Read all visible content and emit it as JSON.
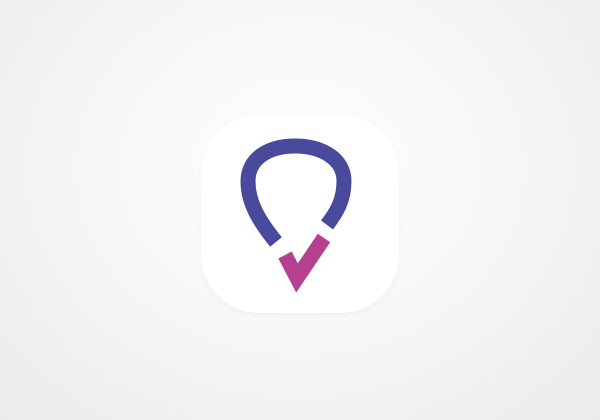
{
  "app_icon": {
    "name": "location-check-app-icon",
    "background": "#ffffff",
    "logo": {
      "pin_color": "#4a4a9c",
      "check_color": "#b5408f",
      "icon_semantic": "location-pin-check-icon"
    }
  },
  "page": {
    "background": "#f3f3f3"
  }
}
